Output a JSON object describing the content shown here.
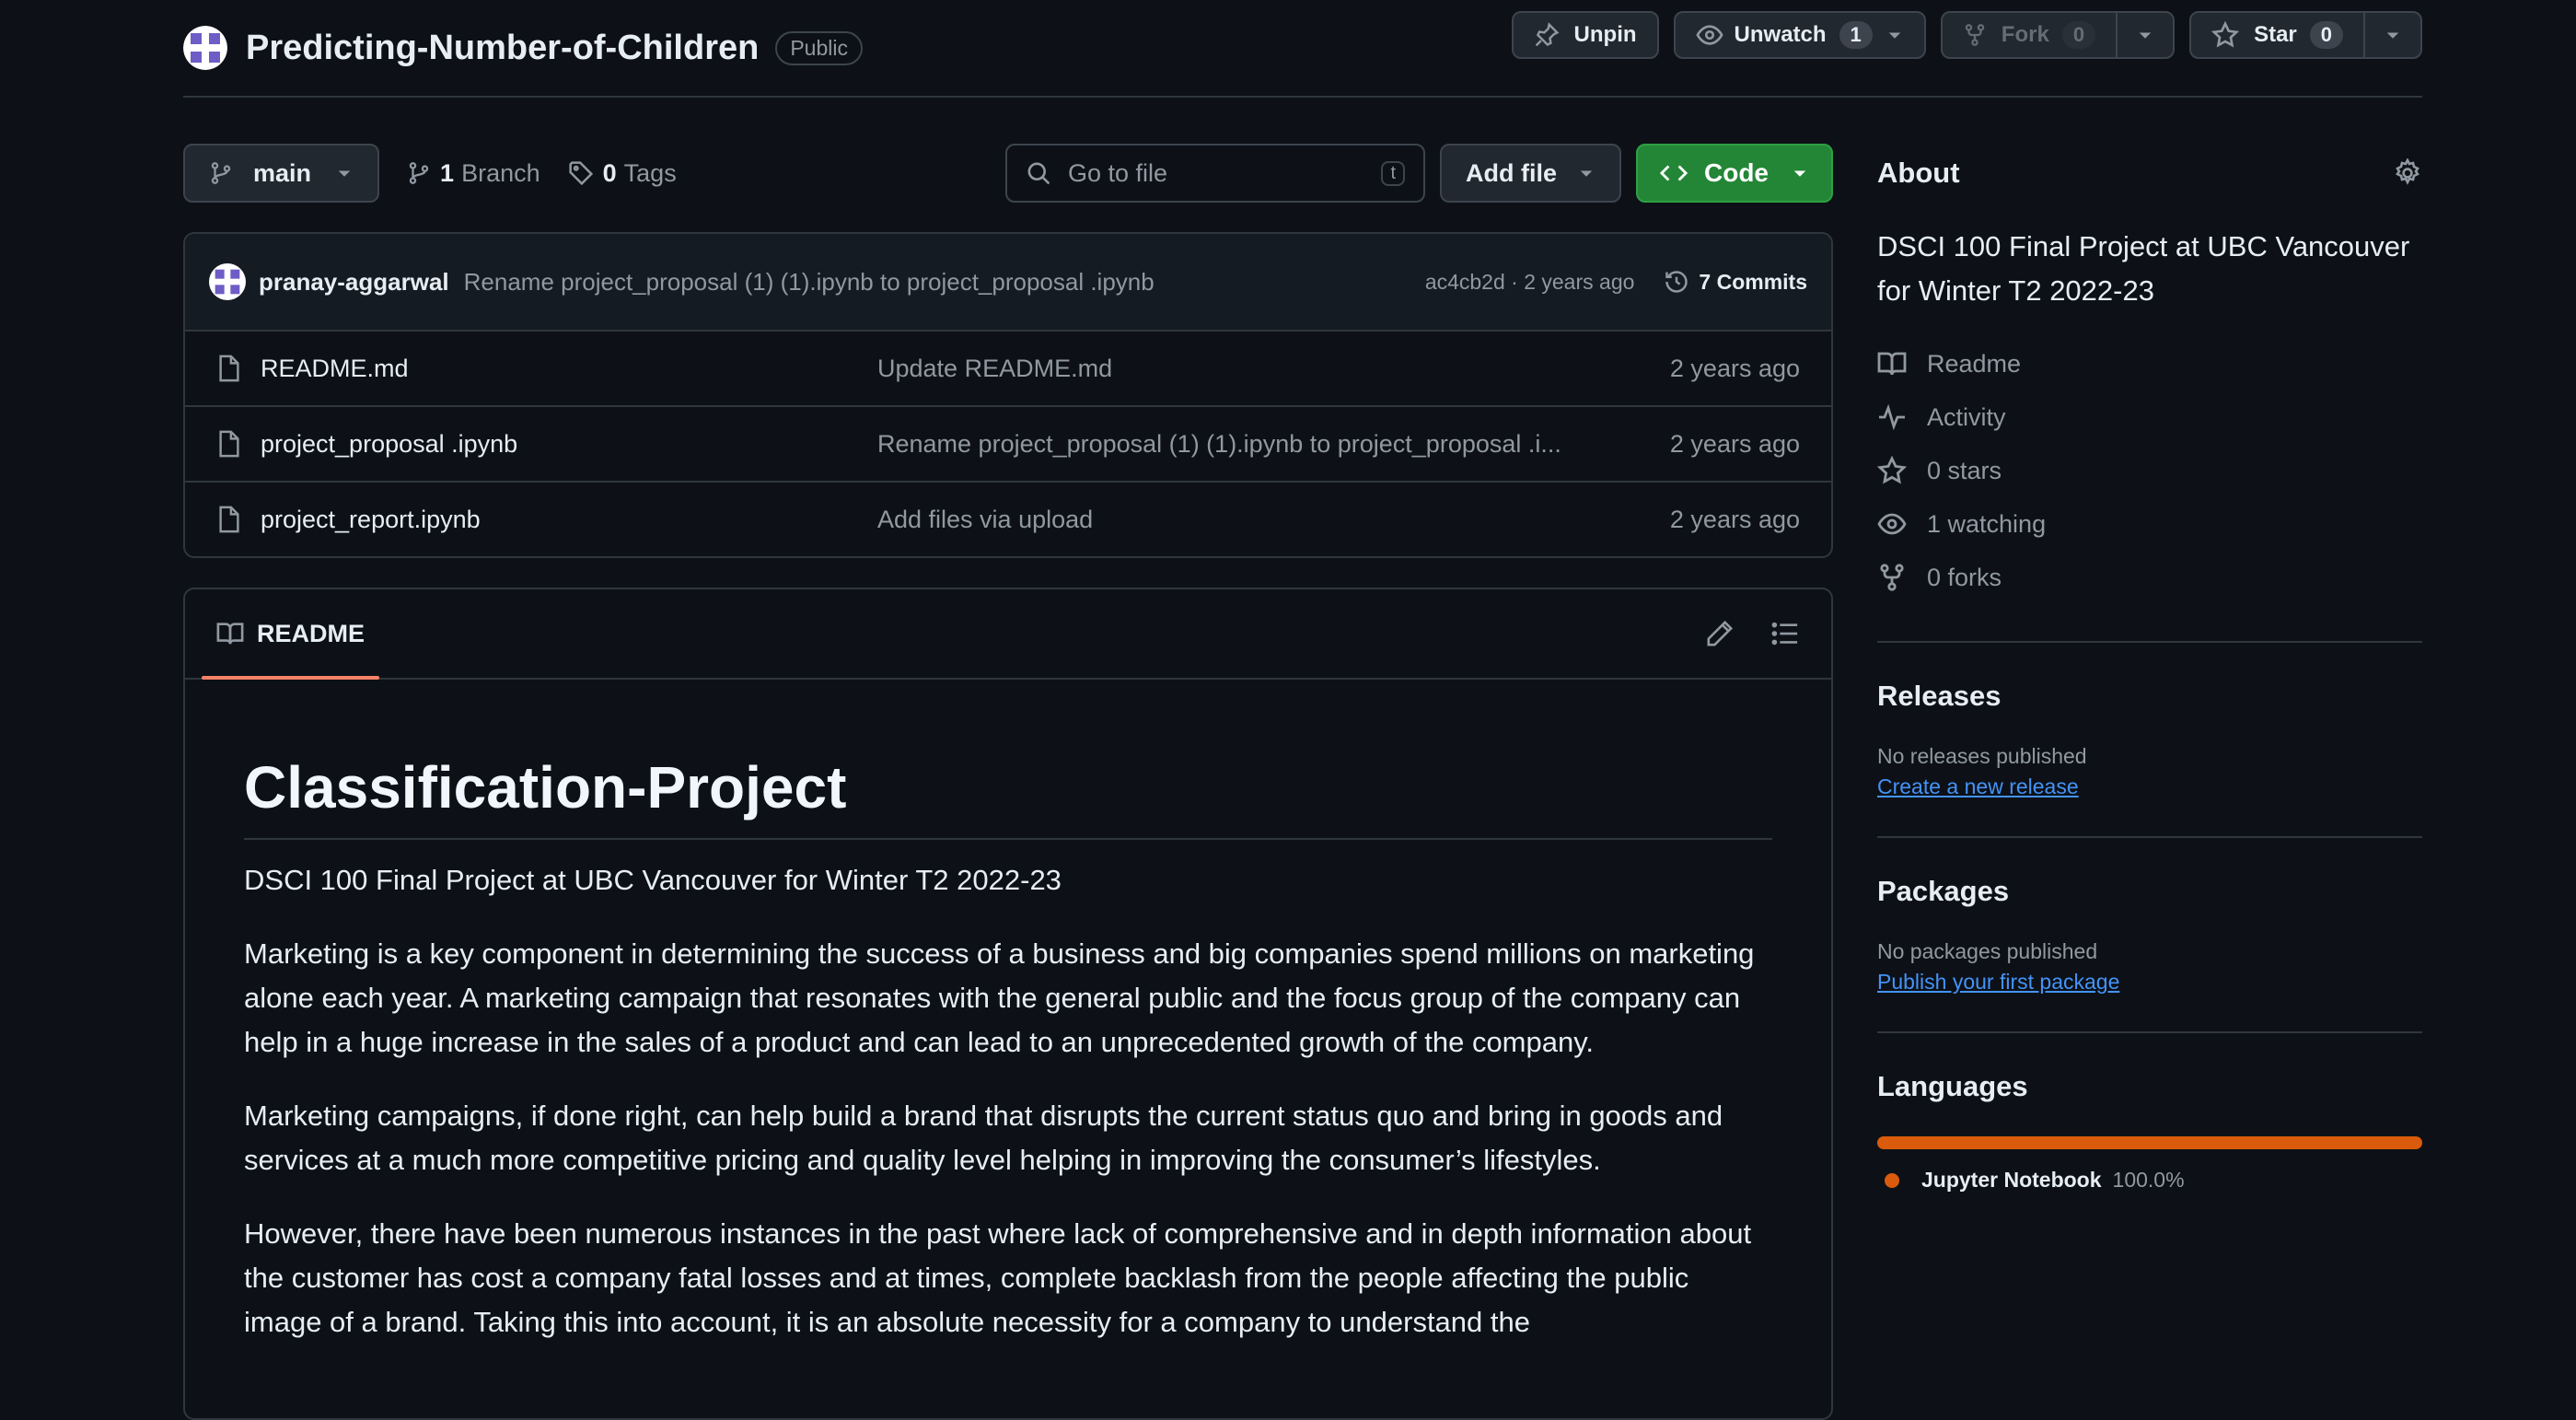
{
  "repo": {
    "name": "Predicting-Number-of-Children",
    "visibility": "Public",
    "actions": {
      "unpin": "Unpin",
      "unwatch": "Unwatch",
      "watch_count": "1",
      "fork": "Fork",
      "fork_count": "0",
      "star": "Star",
      "star_count": "0"
    }
  },
  "toolbar": {
    "branch": "main",
    "branch_count": "1",
    "branch_label": "Branch",
    "tag_count": "0",
    "tag_label": "Tags",
    "goto_placeholder": "Go to file",
    "goto_key": "t",
    "add_file": "Add file",
    "code": "Code"
  },
  "commit": {
    "author": "pranay-aggarwal",
    "message": "Rename project_proposal (1) (1).ipynb to project_proposal .ipynb",
    "sha_time": "ac4cb2d · 2 years ago",
    "commits_label": "7 Commits"
  },
  "files": [
    {
      "name": "README.md",
      "message": "Update README.md",
      "time": "2 years ago"
    },
    {
      "name": "project_proposal .ipynb",
      "message": "Rename project_proposal (1) (1).ipynb to project_proposal .i...",
      "time": "2 years ago"
    },
    {
      "name": "project_report.ipynb",
      "message": "Add files via upload",
      "time": "2 years ago"
    }
  ],
  "readme": {
    "tab": "README",
    "title": "Classification-Project",
    "paragraphs": [
      "DSCI 100 Final Project at UBC Vancouver for Winter T2 2022-23",
      "Marketing is a key component in determining the success of a business and big companies spend millions on marketing alone each year. A marketing campaign that resonates with the general public and the focus group of the company can help in a huge increase in the sales of a product and can lead to an unprecedented growth of the company.",
      "Marketing campaigns, if done right, can help build a brand that disrupts the current status quo and bring in goods and services at a much more competitive pricing and quality level helping in improving the consumer’s lifestyles.",
      "However, there have been numerous instances in the past where lack of comprehensive and in depth information about the customer has cost a company fatal losses and at times, complete backlash from the people affecting the public image of a brand. Taking this into account, it is an absolute necessity for a company to understand the"
    ]
  },
  "about": {
    "title": "About",
    "description": "DSCI 100 Final Project at UBC Vancouver for Winter T2 2022-23",
    "items": {
      "readme": "Readme",
      "activity": "Activity",
      "stars": "0 stars",
      "watching": "1 watching",
      "forks": "0 forks"
    }
  },
  "releases": {
    "title": "Releases",
    "note": "No releases published",
    "link": "Create a new release"
  },
  "packages": {
    "title": "Packages",
    "note": "No packages published",
    "link": "Publish your first package"
  },
  "languages": {
    "title": "Languages",
    "items": [
      {
        "name": "Jupyter Notebook",
        "percent": "100.0%",
        "fraction": 1.0,
        "color": "#da5b0b"
      }
    ]
  },
  "colors": {
    "background": "#0d1117",
    "accent_green": "#238636",
    "link_blue": "#4493f8",
    "tab_underline": "#f78166"
  }
}
